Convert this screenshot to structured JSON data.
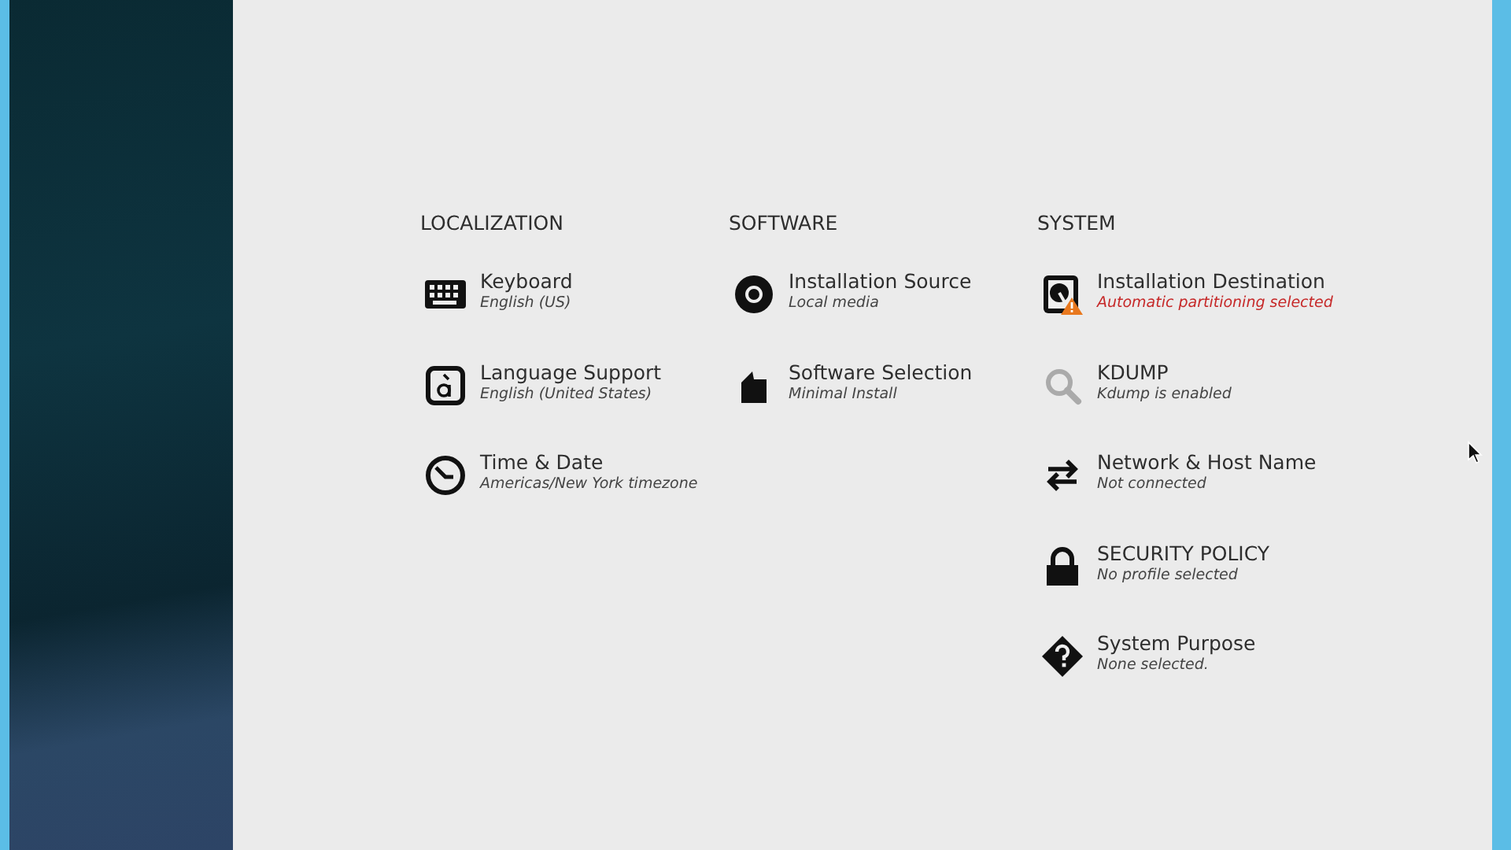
{
  "categories": [
    {
      "title": "LOCALIZATION",
      "spokes": [
        {
          "kind": "keyboard",
          "title": "Keyboard",
          "status": "English (US)",
          "warning": false
        },
        {
          "kind": "language",
          "title": "Language Support",
          "status": "English (United States)",
          "warning": false
        },
        {
          "kind": "clock",
          "title": "Time & Date",
          "status": "Americas/New York timezone",
          "warning": false
        }
      ]
    },
    {
      "title": "SOFTWARE",
      "spokes": [
        {
          "kind": "disc",
          "title": "Installation Source",
          "status": "Local media",
          "warning": false
        },
        {
          "kind": "package",
          "title": "Software Selection",
          "status": "Minimal Install",
          "warning": false
        }
      ]
    },
    {
      "title": "SYSTEM",
      "spokes": [
        {
          "kind": "disk",
          "title": "Installation Destination",
          "status": "Automatic partitioning selected",
          "warning": true
        },
        {
          "kind": "magnifier",
          "title": "KDUMP",
          "status": "Kdump is enabled",
          "warning": false
        },
        {
          "kind": "arrows",
          "title": "Network & Host Name",
          "status": "Not connected",
          "warning": false
        },
        {
          "kind": "lock",
          "title": "SECURITY POLICY",
          "status": "No profile selected",
          "warning": false
        },
        {
          "kind": "question",
          "title": "System Purpose",
          "status": "None selected.",
          "warning": false
        }
      ]
    }
  ]
}
